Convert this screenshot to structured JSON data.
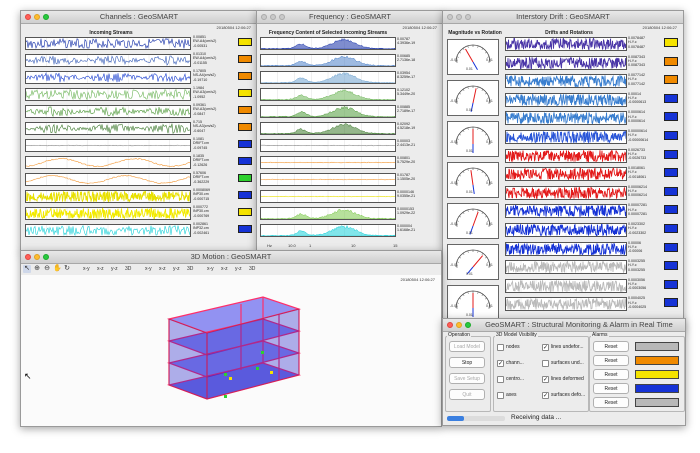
{
  "colors": {
    "yellow": "#f5e300",
    "orange": "#f08a00",
    "green": "#2ed12e",
    "blue": "#1633d6",
    "red": "#e31b1b",
    "gray": "#b8b8b8",
    "white": "#ffffff"
  },
  "channels": {
    "title": "Channels : GeoSMART",
    "timestamp": "20180504 12:06:27",
    "header": "Incoming Streams",
    "rows": [
      {
        "color": "#1530a8",
        "wave": "noise",
        "lines": [
          "0.00851",
          "EW-A4(cm/s2)",
          "-0.00531"
        ],
        "ind": "yellow"
      },
      {
        "color": "#3a5fb8",
        "wave": "burst",
        "lines": [
          "0.01310",
          "EW-A4(cm/s2)",
          "-0.01155"
        ],
        "ind": "orange"
      },
      {
        "color": "#1a3fd0",
        "wave": "burst",
        "lines": [
          "0.17805",
          "NS-A4(cm/s2)",
          "-0.19710"
        ],
        "ind": "orange"
      },
      {
        "color": "#6fb65a",
        "wave": "noise",
        "lines": [
          "1.1984",
          "EW-A3(cm/s2)",
          "-1.0952"
        ],
        "ind": "yellow"
      },
      {
        "color": "#4f9a3a",
        "wave": "burst",
        "lines": [
          "0.09361",
          "EW-A3(cm/s2)",
          "-0.0847"
        ],
        "ind": "orange"
      },
      {
        "color": "#3e7a2e",
        "wave": "burst",
        "lines": [
          "0.715",
          "NS-A3(cm/s2)",
          "-0.6047"
        ],
        "ind": "orange"
      },
      {
        "color": "#8a8a8a",
        "wave": "flat",
        "lines": [
          "0.1081",
          "DRIFT.cm",
          "-0.09745"
        ],
        "ind": "blue"
      },
      {
        "color": "#f29a3a",
        "wave": "slow",
        "lines": [
          "0.1835",
          "DRIFT.cm",
          "-0.12626"
        ],
        "ind": "blue"
      },
      {
        "color": "#f29a3a",
        "wave": "slow",
        "lines": [
          "0.57606",
          "DRIFT.cm",
          "-0.362229"
        ],
        "ind": "green"
      },
      {
        "color": "#e8e000",
        "wave": "dense",
        "lines": [
          "0.0008069",
          "INP30.cm",
          "-0.000715"
        ],
        "ind": "blue"
      },
      {
        "color": "#f2ea00",
        "wave": "dense",
        "lines": [
          "0.000772",
          "INP30.cm",
          "-0.000769"
        ],
        "ind": "yellow"
      },
      {
        "color": "#19d0d8",
        "wave": "noise",
        "lines": [
          "0.002861",
          "INP32.cm",
          "-0.002461"
        ],
        "ind": "blue"
      }
    ]
  },
  "frequency": {
    "title": "Frequency : GeoSMART",
    "timestamp": "20180504 12:06:27",
    "header": "Frequency Content of Selected Incoming Streams",
    "x_axis": [
      "Hz",
      "10.0",
      "1",
      "",
      "10",
      "",
      "15"
    ],
    "rows": [
      {
        "color": "#1530a8",
        "wave": "spectrum",
        "lines": [
          "0.00787",
          "4.3936e-19"
        ]
      },
      {
        "color": "#4f82c8",
        "wave": "spectrum",
        "lines": [
          "0.00685",
          "2.7136e-18"
        ]
      },
      {
        "color": "#6fa3d0",
        "wave": "spectrum",
        "lines": [
          "0.03954",
          "8.3259e-17"
        ]
      },
      {
        "color": "#6fb65a",
        "wave": "spectrum",
        "lines": [
          "0.12102",
          "5.3449e-20"
        ]
      },
      {
        "color": "#4f9a3a",
        "wave": "spectrum",
        "lines": [
          "0.00885",
          "2.7189e-17"
        ]
      },
      {
        "color": "#3e7a2e",
        "wave": "spectrum",
        "lines": [
          "0.02092",
          "4.5218e-19"
        ]
      },
      {
        "color": "#8a8a8a",
        "wave": "flat",
        "lines": [
          "0.00003",
          "2.4413e-21"
        ]
      },
      {
        "color": "#f29a3a",
        "wave": "flat",
        "lines": [
          "0.00801",
          "5.7529e-20"
        ]
      },
      {
        "color": "#f29a3a",
        "wave": "flat",
        "lines": [
          "0.01787",
          "1.1505e-20"
        ]
      },
      {
        "color": "#e8e000",
        "wave": "flat",
        "lines": [
          "0.0000146",
          "9.0355e-21"
        ]
      },
      {
        "color": "#7bc84a",
        "wave": "spectrum",
        "lines": [
          "0.0000153",
          "1.0929e-22"
        ]
      },
      {
        "color": "#19d0d8",
        "wave": "spectrum",
        "lines": [
          "0.000004",
          "1.6168e-21"
        ]
      }
    ]
  },
  "drift": {
    "title": "Interstory Drift : GeoSMART",
    "timestamp": "20180504 12:06:27",
    "header_left": "Magnitude vs Rotation",
    "header_right": "Drifts and Rotations",
    "gauge_labels": [
      "-0.01",
      "0.01",
      "0.01"
    ],
    "rows": [
      {
        "color": "#4b37a8",
        "lines": [
          "0.0078487",
          "H-Y.c",
          "0.0078487"
        ],
        "ind": "yellow"
      },
      {
        "color": "#4b37a8",
        "lines": [
          "0.0087343",
          "H-Y.c",
          "0.0087343"
        ],
        "ind": "orange"
      },
      {
        "color": "#3a7fd0",
        "lines": [
          "0.0077142",
          "H-Y.c",
          "0.0077142"
        ],
        "ind": "orange"
      },
      {
        "color": "#3a7fd0",
        "lines": [
          "0.00014",
          "H-Y.c",
          "-0.0000613"
        ],
        "ind": "blue"
      },
      {
        "color": "#3a7fd0",
        "lines": [
          "0.0000614",
          "H-Y.c",
          "0.0000614"
        ],
        "ind": "blue"
      },
      {
        "color": "#2a56d8",
        "lines": [
          "0.00000614",
          "H-Y.c",
          "-0.00000614"
        ],
        "ind": "blue"
      },
      {
        "color": "#e31b1b",
        "lines": [
          "0.0026733",
          "H-Y.c",
          "-0.0026733"
        ],
        "ind": "blue"
      },
      {
        "color": "#e31b1b",
        "lines": [
          "0.0018061",
          "H-Y.c",
          "-0.0018061"
        ],
        "ind": "blue"
      },
      {
        "color": "#e31b1b",
        "lines": [
          "0.00006214",
          "H-Y.c",
          "0.00006214"
        ],
        "ind": "blue"
      },
      {
        "color": "#1633d6",
        "lines": [
          "0.00007281",
          "H-Y.c",
          "0.00007281"
        ],
        "ind": "blue"
      },
      {
        "color": "#1633d6",
        "lines": [
          "0.0023302",
          "H-Y.c",
          "-0.0023302"
        ],
        "ind": "blue"
      },
      {
        "color": "#1633d6",
        "lines": [
          "0.00006",
          "H-Y.c",
          "-0.00006"
        ],
        "ind": "blue"
      },
      {
        "color": "#ffffff",
        "lines": [
          "0.0003255",
          "H-Y.c",
          "0.0003255"
        ],
        "ind": "blue"
      },
      {
        "color": "#ffffff",
        "lines": [
          "0.0003056",
          "H-Y.c",
          "-0.0003056"
        ],
        "ind": "blue"
      },
      {
        "color": "#ffffff",
        "lines": [
          "0.0004025",
          "H-Y.c",
          "-0.0004025"
        ],
        "ind": "blue"
      }
    ]
  },
  "motion": {
    "title": "3D Motion : GeoSMART",
    "timestamp": "20180504 12:06:27",
    "view_buttons": [
      "x-y",
      "x-z",
      "y-z",
      "3D",
      "x-y",
      "x-z",
      "y-z",
      "3D",
      "x-y",
      "x-z",
      "y-z",
      "3D"
    ]
  },
  "alarm": {
    "title": "GeoSMART : Structural Monitoring & Alarm in Real Time",
    "operation_label": "Operation",
    "operation_buttons": [
      "Load Model",
      "Stop",
      "Save Setup",
      "Quit"
    ],
    "visibility_label": "3D Model Visibility",
    "checkboxes": [
      {
        "label": "nodes",
        "checked": false
      },
      {
        "label": "lines undefor...",
        "checked": true
      },
      {
        "label": "chann...",
        "checked": true
      },
      {
        "label": "surfaces und...",
        "checked": false
      },
      {
        "label": "centro...",
        "checked": false
      },
      {
        "label": "lines deformed",
        "checked": true
      },
      {
        "label": "axes",
        "checked": false
      },
      {
        "label": "surfaces defo...",
        "checked": true
      }
    ],
    "alarms_label": "Alarms",
    "alarms": [
      {
        "label": "Reset",
        "color": "#b8b8b8"
      },
      {
        "label": "Reset",
        "color": "#f08a00"
      },
      {
        "label": "Reset",
        "color": "#f5e300"
      },
      {
        "label": "Reset",
        "color": "#1633d6"
      },
      {
        "label": "Reset",
        "color": "#b8b8b8"
      }
    ],
    "status": "Receiving data ...",
    "progress": 0.3
  }
}
